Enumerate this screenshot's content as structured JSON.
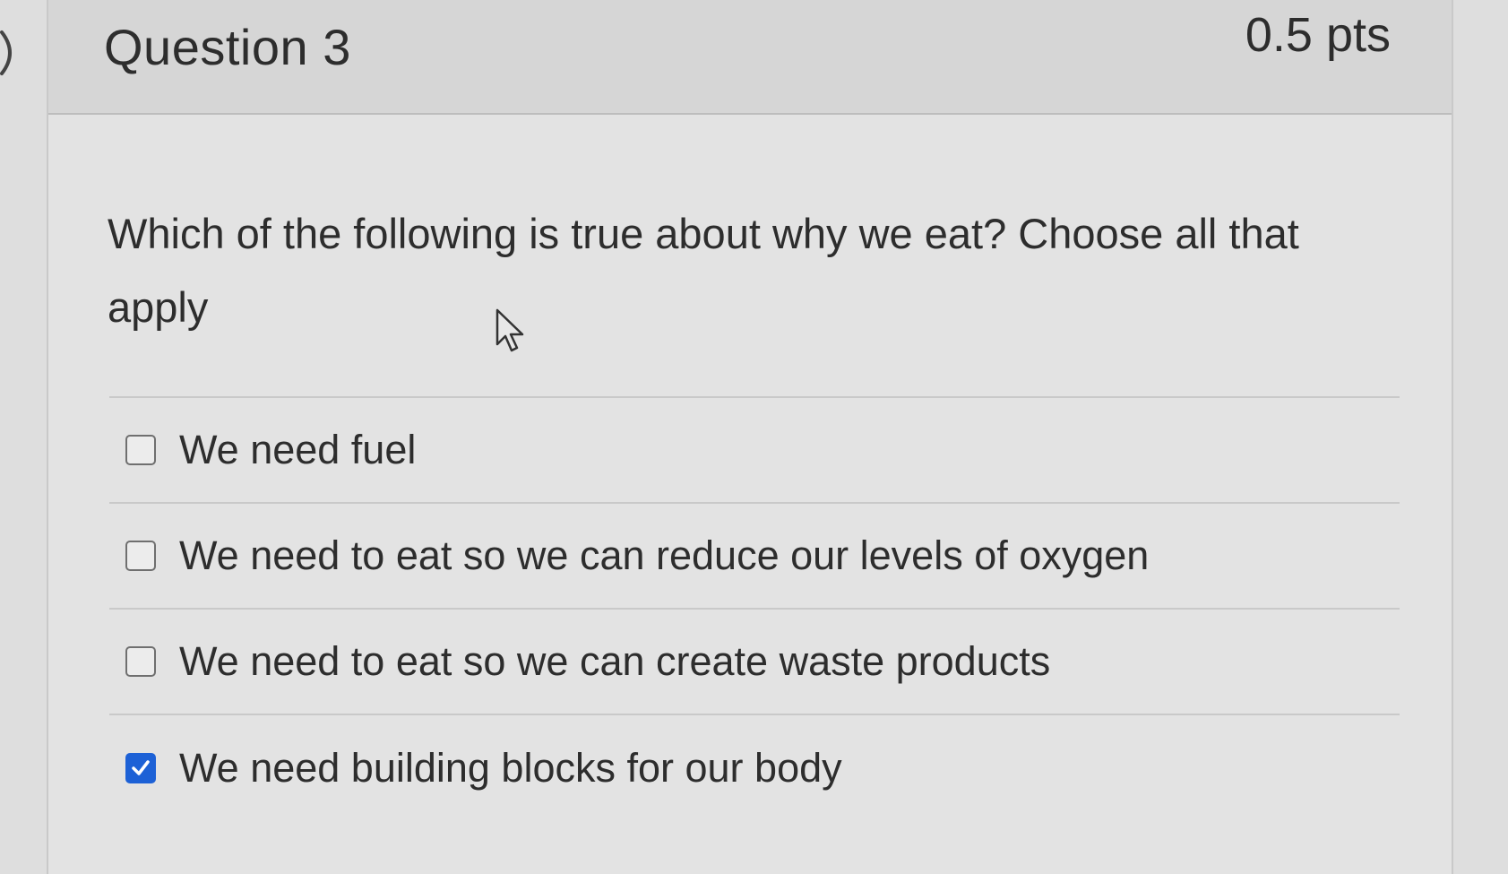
{
  "question": {
    "title": "Question 3",
    "points": "0.5 pts",
    "text": "Which of the following is true about why we eat? Choose all that apply"
  },
  "answers": [
    {
      "label": "We need fuel",
      "checked": false
    },
    {
      "label": "We need to eat so we can reduce our levels of oxygen",
      "checked": false
    },
    {
      "label": "We need to eat so we can create waste products",
      "checked": false
    },
    {
      "label": "We need building blocks for our body",
      "checked": true
    }
  ],
  "colors": {
    "accent": "#1d61d6",
    "text": "#2d2d2d",
    "header_bg": "#d6d6d6"
  },
  "icons": {
    "collapse": "chevron-right-icon",
    "cursor": "mouse-pointer-icon",
    "check": "checkmark-icon"
  }
}
